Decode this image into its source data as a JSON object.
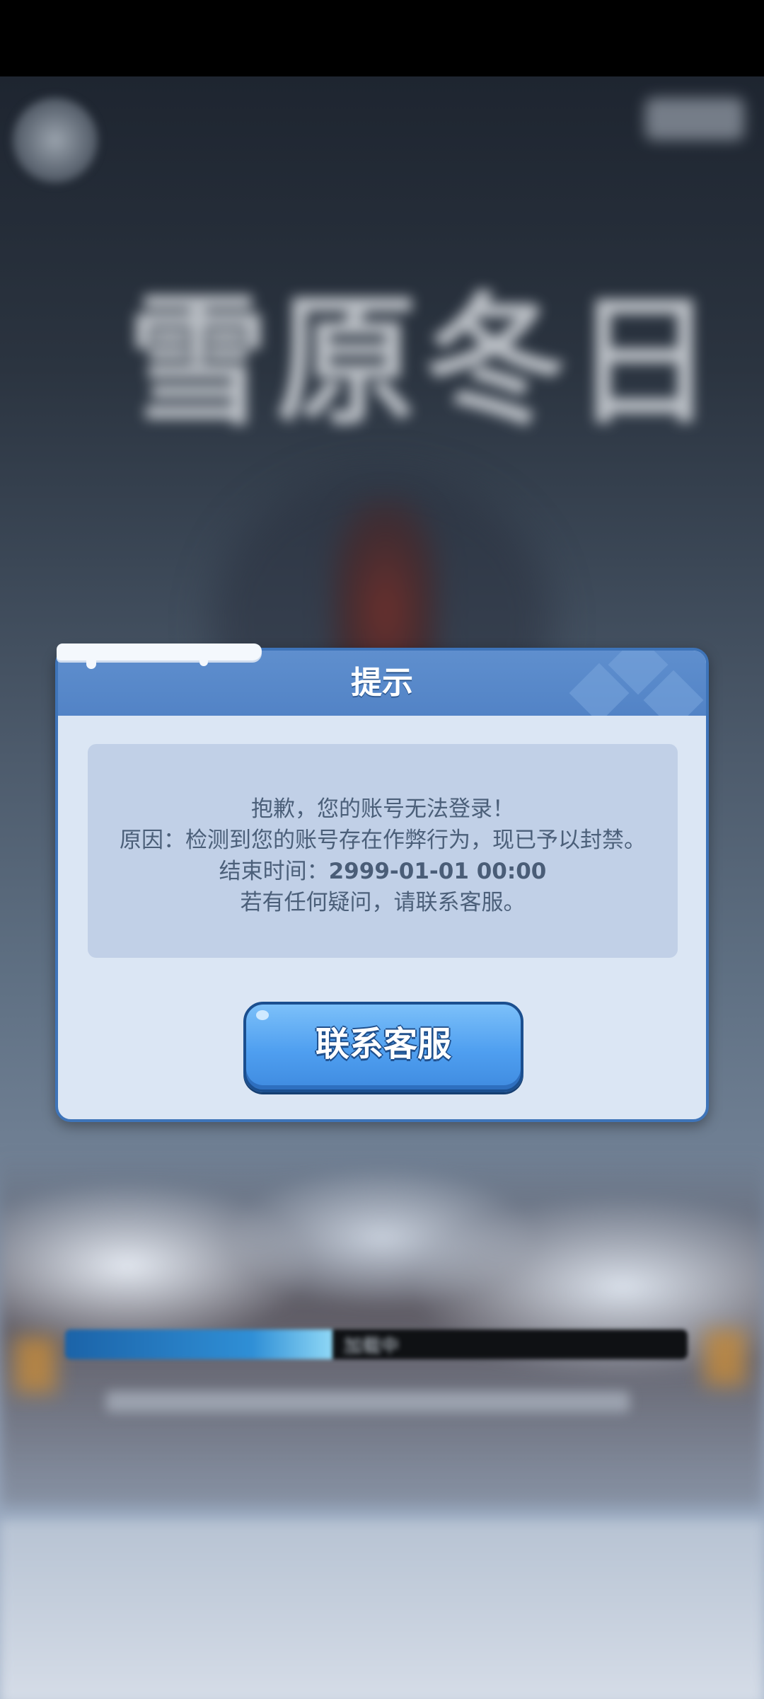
{
  "background": {
    "game_logo": "雪原冬日",
    "loading": {
      "progress": 0.43,
      "label": "加载中"
    }
  },
  "dialog": {
    "title": "提示",
    "message": {
      "line1": "抱歉，您的账号无法登录！",
      "line2": "原因：检测到您的账号存在作弊行为，现已予以封禁。",
      "end_time_label": "结束时间：",
      "end_time_value": "2999-01-01 00:00",
      "line4": "若有任何疑问，请联系客服。"
    },
    "contact_button_label": "联系客服"
  },
  "colors": {
    "dialog_border": "#3e74b9",
    "dialog_header": "#5283c6",
    "dialog_body": "#dbe6f4",
    "message_box": "#c1d0e7",
    "button_blue": "#4f9ff0"
  }
}
